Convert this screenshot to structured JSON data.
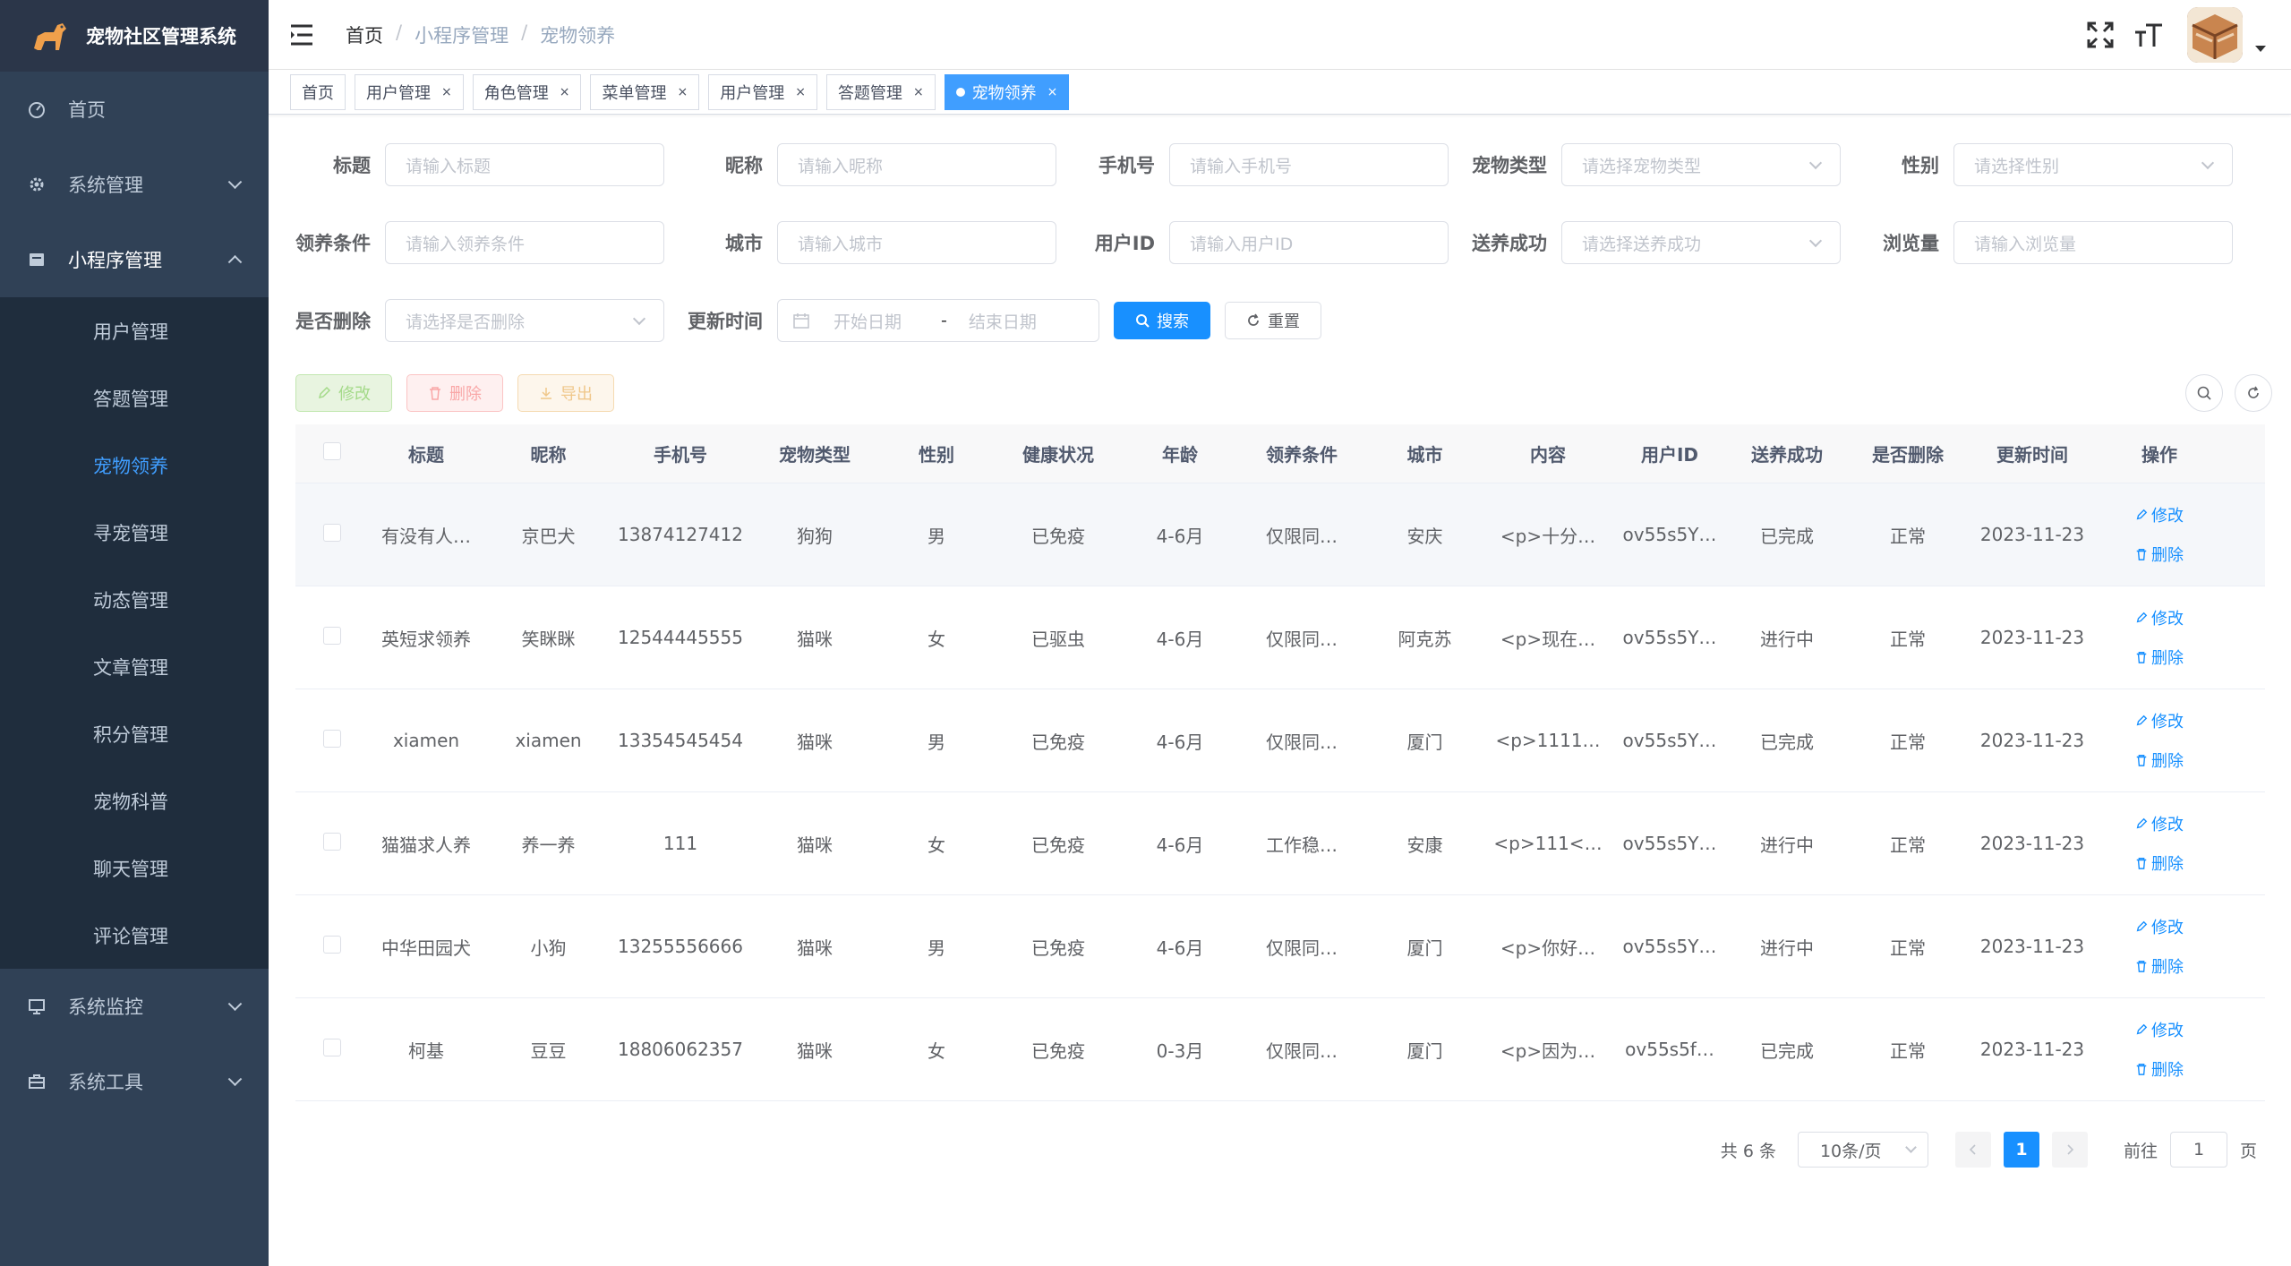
{
  "app": {
    "title": "宠物社区管理系统"
  },
  "sidebar": {
    "items": [
      {
        "label": "首页",
        "icon": "dashboard-icon"
      },
      {
        "label": "系统管理",
        "icon": "gear-icon"
      },
      {
        "label": "小程序管理",
        "icon": "miniapp-icon"
      },
      {
        "label": "系统监控",
        "icon": "monitor-icon"
      },
      {
        "label": "系统工具",
        "icon": "toolbox-icon"
      }
    ],
    "subitems": [
      {
        "label": "用户管理"
      },
      {
        "label": "答题管理"
      },
      {
        "label": "宠物领养"
      },
      {
        "label": "寻宠管理"
      },
      {
        "label": "动态管理"
      },
      {
        "label": "文章管理"
      },
      {
        "label": "积分管理"
      },
      {
        "label": "宠物科普"
      },
      {
        "label": "聊天管理"
      },
      {
        "label": "评论管理"
      }
    ]
  },
  "breadcrumb": {
    "home": "首页",
    "parent": "小程序管理",
    "current": "宠物领养",
    "sep": "/"
  },
  "tags": [
    {
      "label": "首页"
    },
    {
      "label": "用户管理",
      "close": "×"
    },
    {
      "label": "角色管理",
      "close": "×"
    },
    {
      "label": "菜单管理",
      "close": "×"
    },
    {
      "label": "用户管理",
      "close": "×"
    },
    {
      "label": "答题管理",
      "close": "×"
    },
    {
      "label": "宠物领养",
      "close": "×"
    }
  ],
  "form": {
    "title": {
      "label": "标题",
      "placeholder": "请输入标题"
    },
    "nickname": {
      "label": "昵称",
      "placeholder": "请输入昵称"
    },
    "phone": {
      "label": "手机号",
      "placeholder": "请输入手机号"
    },
    "pet_type": {
      "label": "宠物类型",
      "placeholder": "请选择宠物类型"
    },
    "gender": {
      "label": "性别",
      "placeholder": "请选择性别"
    },
    "condition": {
      "label": "领养条件",
      "placeholder": "请输入领养条件"
    },
    "city": {
      "label": "城市",
      "placeholder": "请输入城市"
    },
    "user_id": {
      "label": "用户ID",
      "placeholder": "请输入用户ID"
    },
    "success": {
      "label": "送养成功",
      "placeholder": "请选择送养成功"
    },
    "views": {
      "label": "浏览量",
      "placeholder": "请输入浏览量"
    },
    "deleted": {
      "label": "是否删除",
      "placeholder": "请选择是否删除"
    },
    "update_time": {
      "label": "更新时间",
      "start": "开始日期",
      "sep": "-",
      "end": "结束日期"
    },
    "search": "搜索",
    "reset": "重置"
  },
  "toolbar": {
    "edit": "修改",
    "delete": "删除",
    "export": "导出"
  },
  "table": {
    "headers": [
      "标题",
      "昵称",
      "手机号",
      "宠物类型",
      "性别",
      "健康状况",
      "年龄",
      "领养条件",
      "城市",
      "内容",
      "用户ID",
      "送养成功",
      "是否删除",
      "更新时间",
      "操作"
    ],
    "edit_label": "修改",
    "delete_label": "删除",
    "rows": [
      [
        "有没有人…",
        "京巴犬",
        "13874127412",
        "狗狗",
        "男",
        "已免疫",
        "4-6月",
        "仅限同…",
        "安庆",
        "<p>十分…",
        "ov55s5Y…",
        "已完成",
        "正常",
        "2023-11-23"
      ],
      [
        "英短求领养",
        "笑眯眯",
        "12544445555",
        "猫咪",
        "女",
        "已驱虫",
        "4-6月",
        "仅限同…",
        "阿克苏",
        "<p>现在…",
        "ov55s5Y…",
        "进行中",
        "正常",
        "2023-11-23"
      ],
      [
        "xiamen",
        "xiamen",
        "13354545454",
        "猫咪",
        "男",
        "已免疫",
        "4-6月",
        "仅限同…",
        "厦门",
        "<p>1111…",
        "ov55s5Y…",
        "已完成",
        "正常",
        "2023-11-23"
      ],
      [
        "猫猫求人养",
        "养一养",
        "111",
        "猫咪",
        "女",
        "已免疫",
        "4-6月",
        "工作稳…",
        "安康",
        "<p>111<…",
        "ov55s5Y…",
        "进行中",
        "正常",
        "2023-11-23"
      ],
      [
        "中华田园犬",
        "小狗",
        "13255556666",
        "猫咪",
        "男",
        "已免疫",
        "4-6月",
        "仅限同…",
        "厦门",
        "<p>你好…",
        "ov55s5Y…",
        "进行中",
        "正常",
        "2023-11-23"
      ],
      [
        "柯基",
        "豆豆",
        "18806062357",
        "猫咪",
        "女",
        "已免疫",
        "0-3月",
        "仅限同…",
        "厦门",
        "<p>因为…",
        "ov55s5f…",
        "已完成",
        "正常",
        "2023-11-23"
      ]
    ]
  },
  "pagination": {
    "total": "共 6 条",
    "page_size": "10条/页",
    "current": "1",
    "goto": "前往",
    "goto_value": "1",
    "page_unit": "页"
  },
  "colors": {
    "sidebar": "#304156",
    "submenu": "#1f2d3d",
    "primary": "#1890ff",
    "active_menu": "#409eff"
  }
}
